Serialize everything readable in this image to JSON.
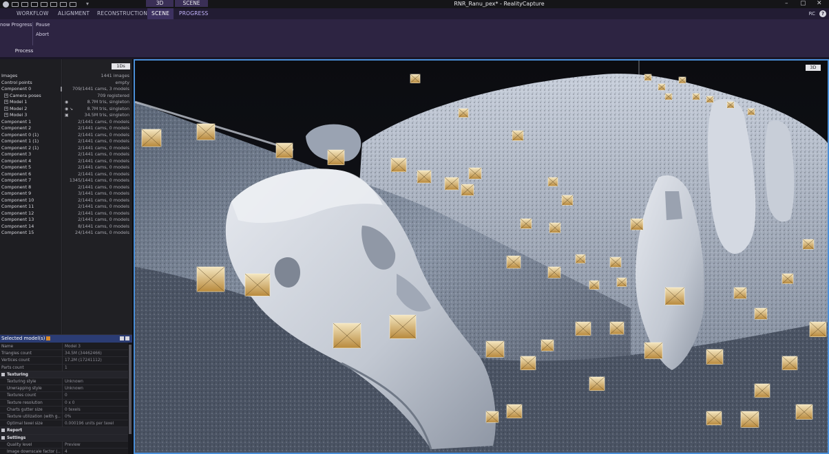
{
  "window": {
    "title": "RNR_Ranu_pex* - RealityCapture",
    "view_tabs": [
      "3D",
      "SCENE"
    ]
  },
  "ribbon": {
    "tabs": [
      "WORKFLOW",
      "ALIGNMENT",
      "RECONSTRUCTION",
      "SCENE",
      "PROGRESS"
    ],
    "active_tab": "SCENE",
    "right_label": "RC",
    "help_icon": "?",
    "items": {
      "show_progress": "now Progress",
      "pause": "Pause",
      "abort": "Abort"
    },
    "group_label": "Process"
  },
  "tree": {
    "header_button": "1Ds",
    "rows": [
      {
        "label": "Images",
        "value": "1441 images",
        "indent": false
      },
      {
        "label": "Control points",
        "value": "empty",
        "indent": false
      },
      {
        "label": "Component 0",
        "value": "709/1441 cams, 3 models",
        "indent": false,
        "bar": true
      },
      {
        "label": "Camera poses",
        "value": "709 registered",
        "indent": true,
        "plus": true
      },
      {
        "label": "Model 1",
        "value": "8.7M tris, singleton",
        "indent": true,
        "plus": true,
        "eye": "◉"
      },
      {
        "label": "Model 2",
        "value": "8.7M tris, singleton",
        "indent": true,
        "plus": true,
        "eye": "◉ ↘"
      },
      {
        "label": "Model 3",
        "value": "34.5M tris, singleton",
        "indent": true,
        "plus": true,
        "eye": "▣"
      },
      {
        "label": "Component 1",
        "value": "2/1441 cams, 0 models",
        "indent": false
      },
      {
        "label": "Component 2",
        "value": "2/1441 cams, 0 models",
        "indent": false
      },
      {
        "label": "Component 0 (1)",
        "value": "2/1441 cams, 0 models",
        "indent": false
      },
      {
        "label": "Component 1 (1)",
        "value": "2/1441 cams, 0 models",
        "indent": false
      },
      {
        "label": "Component 2 (1)",
        "value": "2/1441 cams, 0 models",
        "indent": false
      },
      {
        "label": "Component 3",
        "value": "2/1441 cams, 0 models",
        "indent": false
      },
      {
        "label": "Component 4",
        "value": "2/1441 cams, 0 models",
        "indent": false
      },
      {
        "label": "Component 5",
        "value": "2/1441 cams, 0 models",
        "indent": false
      },
      {
        "label": "Component 6",
        "value": "2/1441 cams, 0 models",
        "indent": false
      },
      {
        "label": "Component 7",
        "value": "1345/1441 cams, 0 models",
        "indent": false
      },
      {
        "label": "Component 8",
        "value": "2/1441 cams, 0 models",
        "indent": false
      },
      {
        "label": "Component 9",
        "value": "3/1441 cams, 0 models",
        "indent": false
      },
      {
        "label": "Component 10",
        "value": "2/1441 cams, 0 models",
        "indent": false
      },
      {
        "label": "Component 11",
        "value": "2/1441 cams, 0 models",
        "indent": false
      },
      {
        "label": "Component 12",
        "value": "2/1441 cams, 0 models",
        "indent": false
      },
      {
        "label": "Component 13",
        "value": "2/1441 cams, 0 models",
        "indent": false
      },
      {
        "label": "Component 14",
        "value": "8/1441 cams, 0 models",
        "indent": false
      },
      {
        "label": "Component 15",
        "value": "24/1441 cams, 0 models",
        "indent": false
      }
    ]
  },
  "selected_panel": {
    "title": "Selected model(s)",
    "rows": [
      {
        "key": "Name",
        "value": "Model 3",
        "type": "prop"
      },
      {
        "key": "Triangles count",
        "value": "34.5M (34462466)",
        "type": "prop"
      },
      {
        "key": "Vertices count",
        "value": "17.2M (17241112)",
        "type": "prop"
      },
      {
        "key": "Parts count",
        "value": "1",
        "type": "prop"
      },
      {
        "key": "Texturing",
        "value": "",
        "type": "section"
      },
      {
        "key": "Texturing style",
        "value": "Unknown",
        "type": "sub"
      },
      {
        "key": "Unwrapping style",
        "value": "Unknown",
        "type": "sub"
      },
      {
        "key": "Textures count",
        "value": "0",
        "type": "sub"
      },
      {
        "key": "Texture resolution",
        "value": "0 x 0",
        "type": "sub"
      },
      {
        "key": "Charts gutter size",
        "value": "0 texels",
        "type": "sub"
      },
      {
        "key": "Texture utilization (with g...",
        "value": "0%",
        "type": "sub"
      },
      {
        "key": "Optimal texel size",
        "value": "0.000196 units per texel",
        "type": "sub"
      },
      {
        "key": "Report",
        "value": "",
        "type": "section"
      },
      {
        "key": "Settings",
        "value": "",
        "type": "section"
      },
      {
        "key": "Quality level",
        "value": "Preview",
        "type": "sub"
      },
      {
        "key": "Image downscale factor (...",
        "value": "4",
        "type": "sub"
      }
    ]
  },
  "viewport": {
    "badge": "3D"
  }
}
